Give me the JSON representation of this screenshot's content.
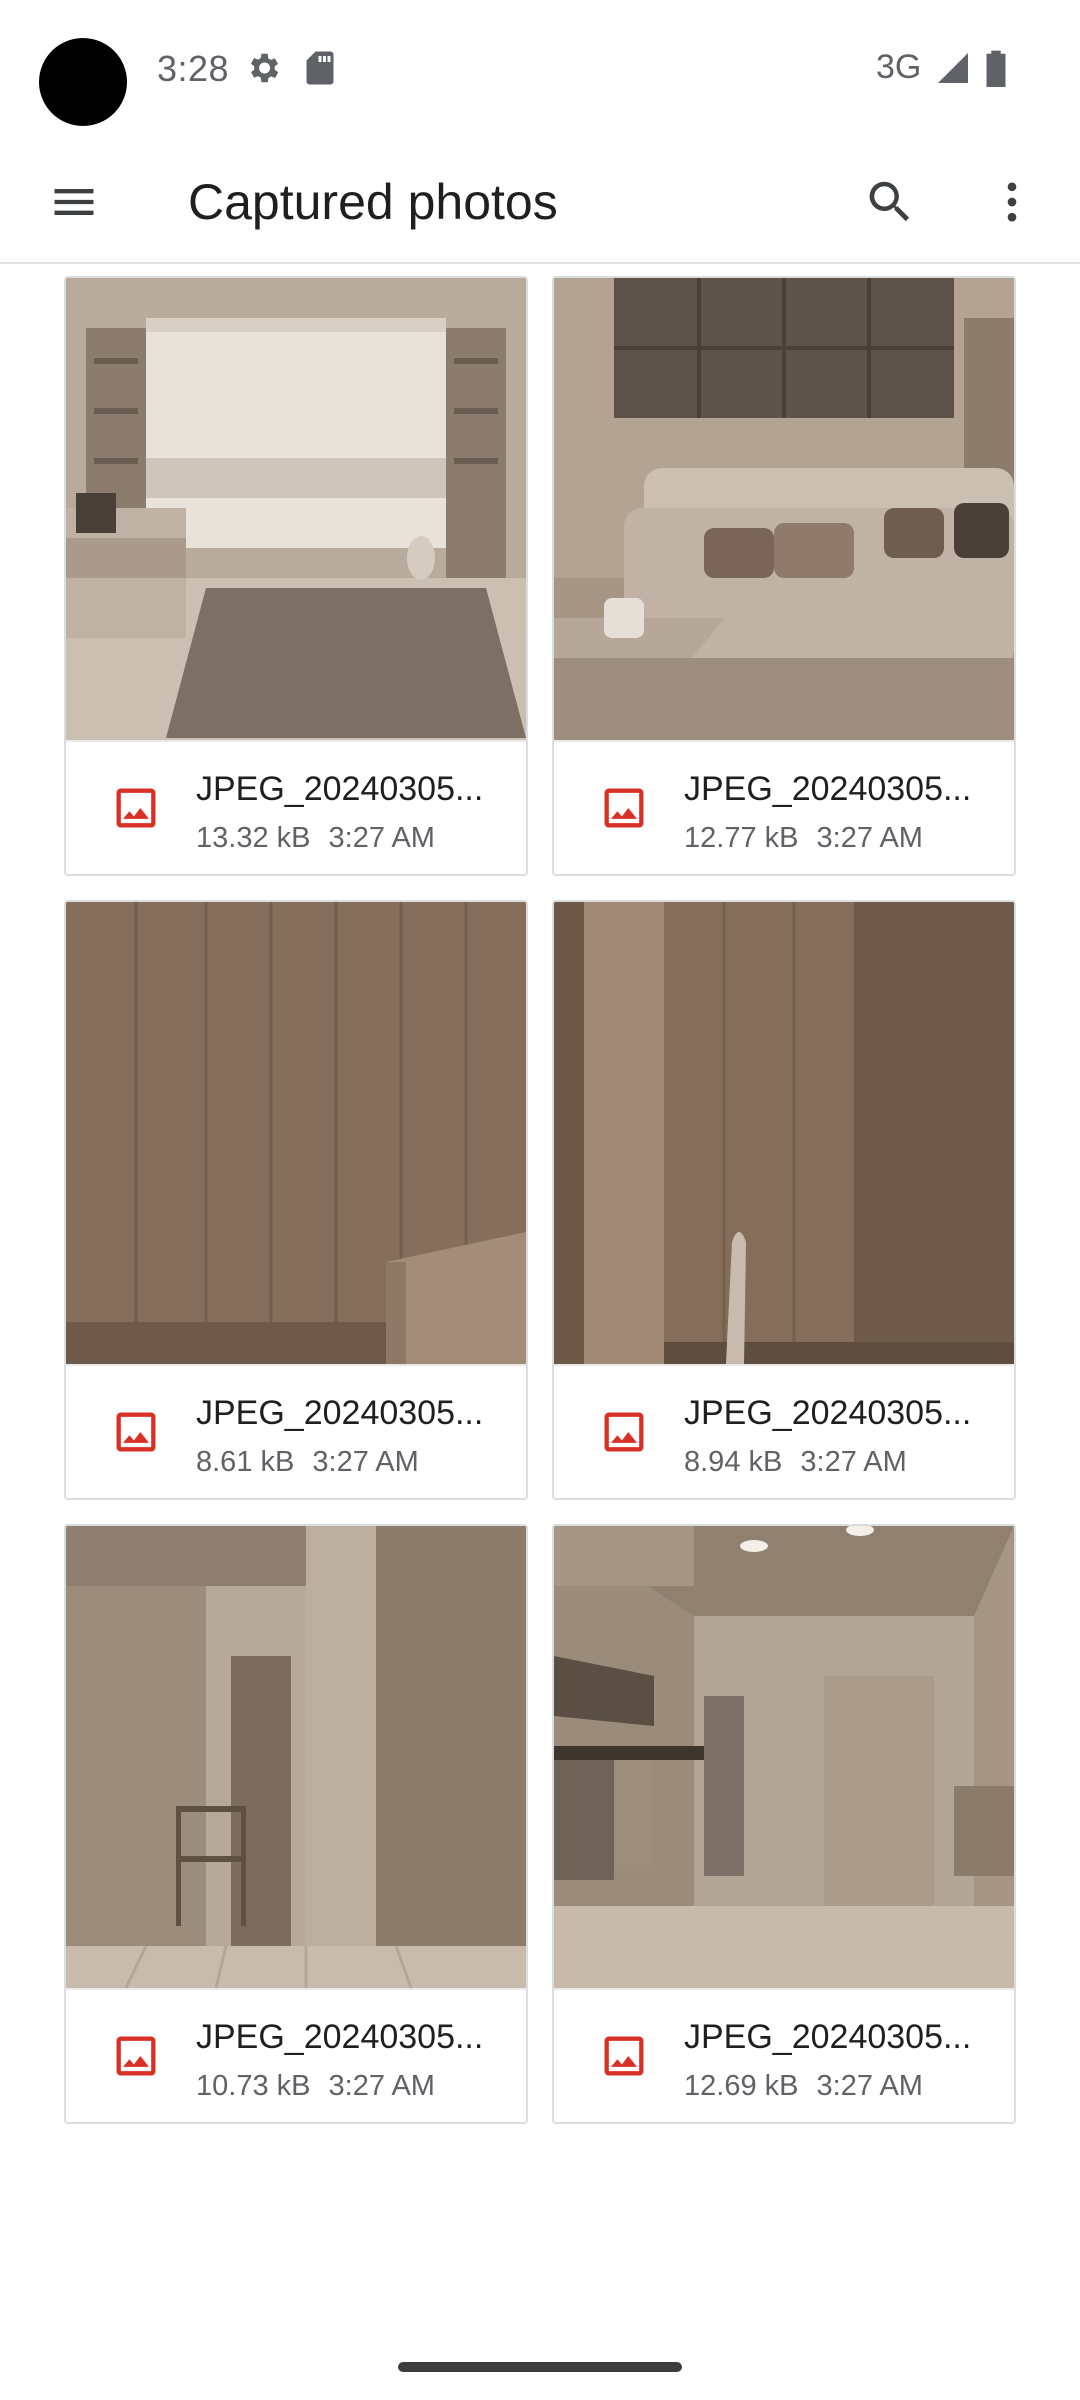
{
  "status_bar": {
    "time": "3:28",
    "network": "3G",
    "icons": [
      "settings-gear-icon",
      "sd-card-icon",
      "signal-icon",
      "battery-icon"
    ]
  },
  "app_bar": {
    "title": "Captured photos",
    "icons": [
      "menu-icon",
      "search-icon",
      "more-vert-icon"
    ]
  },
  "accent_color": "#d93025",
  "files": [
    {
      "name": "JPEG_20240305...",
      "size": "13.32 kB",
      "time": "3:27 AM"
    },
    {
      "name": "JPEG_20240305...",
      "size": "12.77 kB",
      "time": "3:27 AM"
    },
    {
      "name": "JPEG_20240305...",
      "size": "8.61 kB",
      "time": "3:27 AM"
    },
    {
      "name": "JPEG_20240305...",
      "size": "8.94 kB",
      "time": "3:27 AM"
    },
    {
      "name": "JPEG_20240305...",
      "size": "10.73 kB",
      "time": "3:27 AM"
    },
    {
      "name": "JPEG_20240305...",
      "size": "12.69 kB",
      "time": "3:27 AM"
    }
  ]
}
